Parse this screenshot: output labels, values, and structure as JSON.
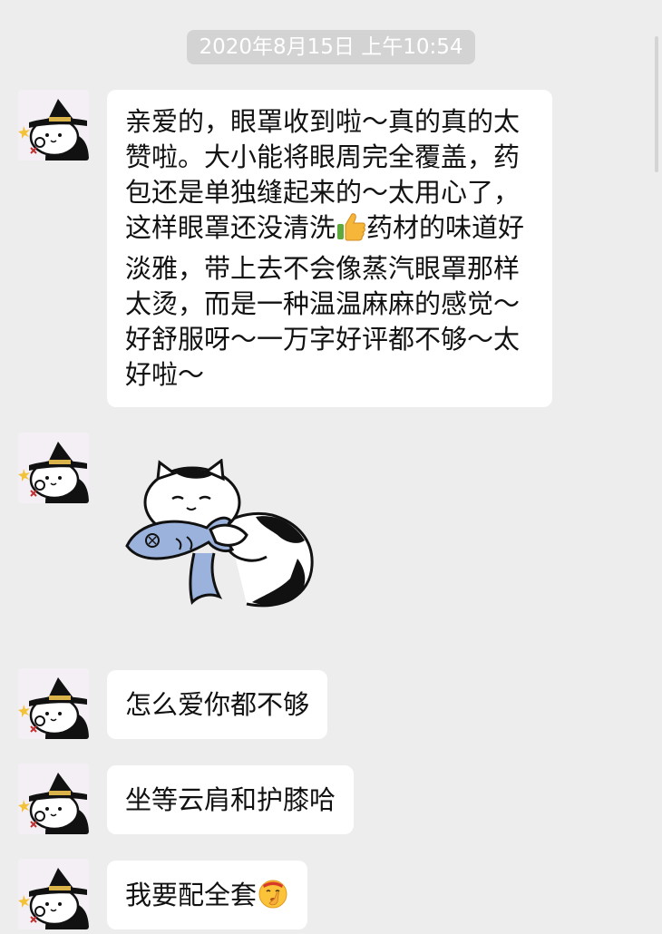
{
  "chat": {
    "timestamp": "2020年8月15日 上午10:54",
    "messages": [
      {
        "type": "text",
        "text_part1": "亲爱的，眼罩收到啦～真的真的太赞啦。大小能将眼周完全覆盖，药包还是单独缝起来的～太用心了，这样眼罩还没清洗",
        "emoji": "thumbs-up-icon",
        "text_part2": "药材的味道好淡雅，带上去不会像蒸汽眼罩那样太烫，而是一种温温麻麻的感觉～好舒服呀～一万字好评都不够～太好啦～"
      },
      {
        "type": "sticker",
        "sticker": "cat-hugging-fish-sticker"
      },
      {
        "type": "text",
        "text": "怎么爱你都不够"
      },
      {
        "type": "text",
        "text": "坐等云肩和护膝哈"
      },
      {
        "type": "text",
        "text": "我要配全套",
        "emoji": "shushing-face-icon"
      }
    ]
  },
  "colors": {
    "background": "#ededed",
    "bubble": "#ffffff",
    "timestamp_bg": "#d3d3d3",
    "text": "#111111"
  }
}
